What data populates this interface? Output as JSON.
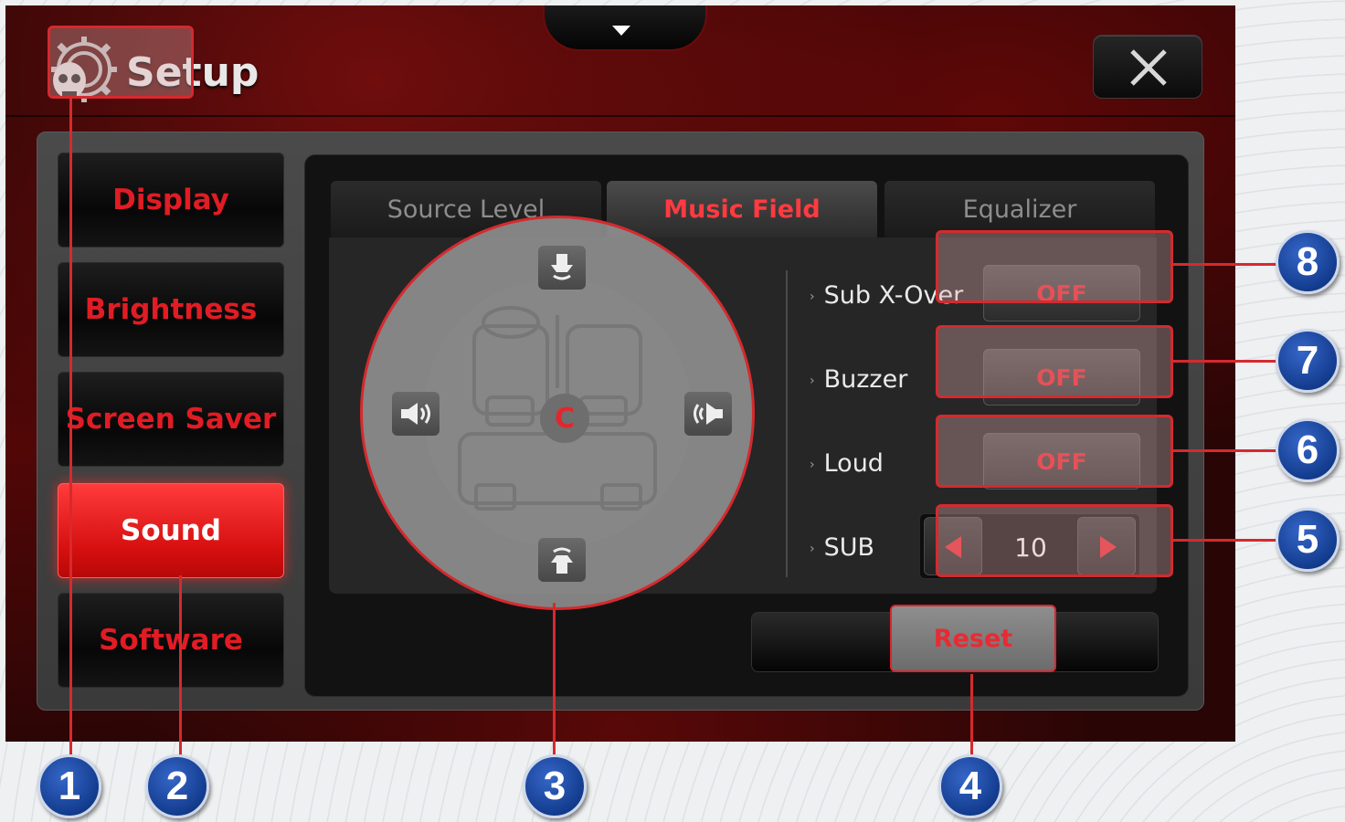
{
  "header": {
    "title": "Setup"
  },
  "sidebar": {
    "items": [
      {
        "label": "Display"
      },
      {
        "label": "Brightness"
      },
      {
        "label": "Screen Saver"
      },
      {
        "label": "Sound",
        "active": true
      },
      {
        "label": "Software"
      }
    ]
  },
  "tabs": [
    {
      "label": "Source Level"
    },
    {
      "label": "Music Field",
      "active": true
    },
    {
      "label": "Equalizer"
    }
  ],
  "settings": {
    "sub_xover": {
      "label": "Sub X-Over",
      "value": "OFF"
    },
    "buzzer": {
      "label": "Buzzer",
      "value": "OFF"
    },
    "loud": {
      "label": "Loud",
      "value": "OFF"
    },
    "sub": {
      "label": "SUB",
      "value": "10"
    }
  },
  "field": {
    "center_label": "C"
  },
  "reset_label": "Reset",
  "markers": [
    "1",
    "2",
    "3",
    "4",
    "5",
    "6",
    "7",
    "8"
  ],
  "colors": {
    "accent": "#d52a2e",
    "marker_blue": "#1b4aa6",
    "active_tab_text": "#ff3a40"
  }
}
